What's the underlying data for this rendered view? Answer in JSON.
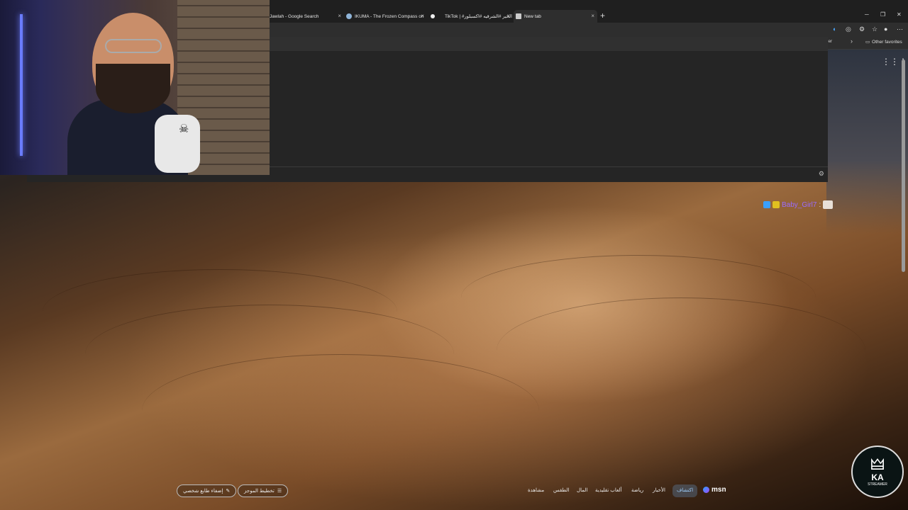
{
  "browser": {
    "tabs": [
      {
        "title": "Jawlah - Google Search",
        "icon": "google-icon",
        "active": false
      },
      {
        "title": "IKUMA - The Frozen Compass on",
        "icon": "steam-icon",
        "active": false
      },
      {
        "title": "TikTok | #الخير #الشرقيه #اكسبلور",
        "icon": "tiktok-icon",
        "active": false
      },
      {
        "title": "New tab",
        "icon": "new-tab-page-icon",
        "active": true
      }
    ],
    "new_tab_symbol": "+",
    "window_controls": {
      "minimize": "─",
      "restore": "❐",
      "close": "✕"
    },
    "favorites": {
      "truncated_item": "ler",
      "overflow": "›",
      "other_favorites": "Other favorites"
    },
    "toolbar_icons": [
      "read-aloud-icon",
      "copilot-icon",
      "extensions-icon",
      "favorites-star-icon",
      "profile-icon",
      "more-menu-icon"
    ]
  },
  "chat": {
    "username": "Baby_Girl7",
    "separator": ":",
    "badges": [
      "subscriber-badge-icon",
      "vip-badge-icon"
    ],
    "emote": "emote-icon"
  },
  "msn": {
    "logo_text": "msn",
    "nav": [
      {
        "label": "اكتشاف",
        "active": true
      },
      {
        "label": "الأخبار",
        "active": false
      },
      {
        "label": "رياضة",
        "active": false
      },
      {
        "label": "ألعاب تقليدية",
        "active": false
      },
      {
        "label": "المال",
        "active": false
      },
      {
        "label": "الطقس",
        "active": false
      },
      {
        "label": "مشاهدة",
        "active": false
      }
    ],
    "pills": [
      {
        "label": "تخطيط الموجز",
        "icon": "layout-icon"
      },
      {
        "label": "إضفاء طابع شخصي",
        "icon": "personalize-icon"
      }
    ]
  },
  "stream_logo": {
    "text": "KA",
    "sub": "STREAMER"
  },
  "colors": {
    "accent": "#9fd0ff",
    "chat_username": "#9a6bff",
    "chrome_bg": "#1f1f1f"
  }
}
